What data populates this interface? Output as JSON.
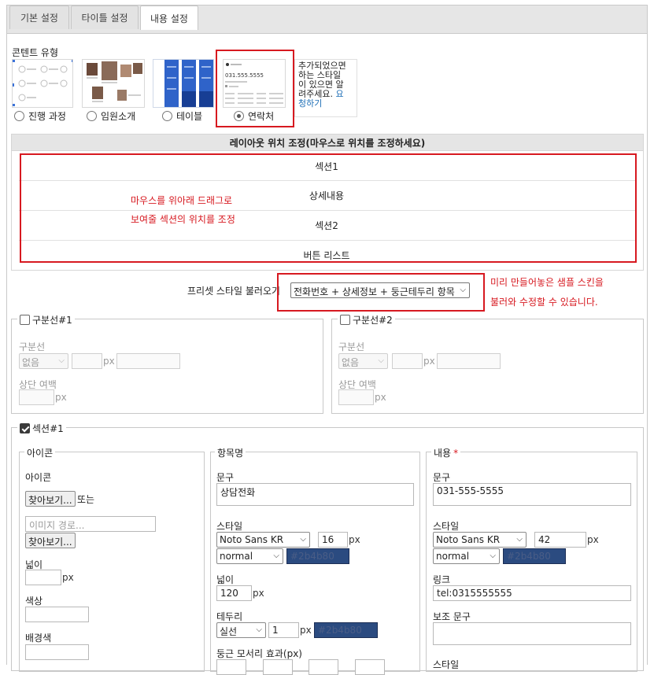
{
  "tabs": [
    {
      "label": "기본 설정"
    },
    {
      "label": "타이틀 설정"
    },
    {
      "label": "내용 설정"
    }
  ],
  "content_type": {
    "label": "콘텐트 유형",
    "options": [
      {
        "label": "진행 과정",
        "selected": false
      },
      {
        "label": "임원소개",
        "selected": false
      },
      {
        "label": "테이블",
        "selected": false
      },
      {
        "label": "연락처",
        "selected": true
      }
    ],
    "note_lines": [
      "추가되었으면",
      "하는 스타일",
      "이 있으면 알",
      "려주세요."
    ],
    "note_link_a": "요",
    "note_link_b": "청하기"
  },
  "contact_preview": {
    "phone": "031.555.5555"
  },
  "layout": {
    "header": "레이아웃 위치 조정(마우스로 위치를 조정하세요)",
    "rows": [
      "섹션1",
      "상세내용",
      "섹션2",
      "버튼 리스트"
    ],
    "hint_line1": "마우스를 위아래 드래그로",
    "hint_line2": "보여줄 섹션의 위치를 조정"
  },
  "preset": {
    "label": "프리셋 스타일 불러오기",
    "value": "전화번호 + 상세정보 + 둥근테두리 항목",
    "hint_line1": "미리 만들어놓은 샘플 스킨을",
    "hint_line2": "불러와 수정할 수 있습니다."
  },
  "divider1": {
    "legend": "구분선#1",
    "checked": false,
    "line_label": "구분선",
    "line_value": "없음",
    "px": "px",
    "top_margin_label": "상단 여백"
  },
  "divider2": {
    "legend": "구분선#2",
    "checked": false,
    "line_label": "구분선",
    "line_value": "없음",
    "px": "px",
    "top_margin_label": "상단 여백"
  },
  "section1": {
    "legend": "섹션#1",
    "checked": true,
    "icon_group": {
      "legend": "아이콘",
      "icon_label": "아이콘",
      "browse_label": "찾아보기...",
      "or_label": "또는",
      "path_placeholder": "이미지 경로...",
      "browse2_label": "찾아보기...",
      "width_label": "넓이",
      "px": "px",
      "color_label": "색상",
      "bg_label": "배경색"
    },
    "item_group": {
      "legend": "항목명",
      "text_label": "문구",
      "text_value": "상담전화",
      "style_label": "스타일",
      "font": "Noto Sans KR",
      "size": "16",
      "px": "px",
      "weight": "normal",
      "color": "#2b4b80",
      "width_label": "넓이",
      "width_value": "120",
      "border_label": "테두리",
      "border_style": "실선",
      "border_width": "1",
      "border_color": "#2b4b80",
      "radius_label": "둥근 모서리 효과(px)"
    },
    "content_group": {
      "legend": "내용",
      "required_mark": "*",
      "text_label": "문구",
      "text_value": "031-555-5555",
      "style_label": "스타일",
      "font": "Noto Sans KR",
      "size": "42",
      "px": "px",
      "weight": "normal",
      "color": "#2b4b80",
      "link_label": "링크",
      "link_value": "tel:0315555555",
      "sub_text_label": "보조 문구",
      "sub_style_label": "스타일"
    }
  },
  "colors": {
    "accent_red": "#d71920",
    "swatch": "#2b4b80"
  }
}
